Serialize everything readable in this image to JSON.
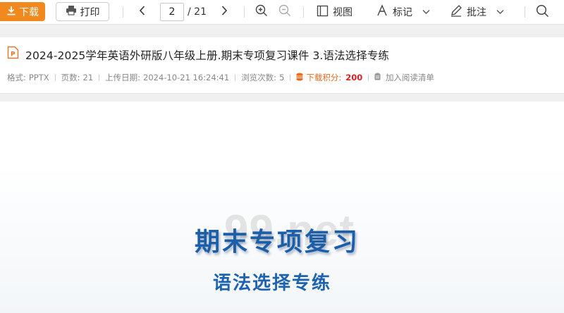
{
  "toolbar": {
    "download_label": "下载",
    "print_label": "打印",
    "current_page": "2",
    "total_pages": "/ 21",
    "view_label": "视图",
    "mark_label": "标记",
    "annotate_label": "批注"
  },
  "document": {
    "title": "2024-2025学年英语外研版八年级上册.期末专项复习课件 3.语法选择专练",
    "meta": {
      "format_label": "格式:",
      "format_value": "PPTX",
      "pages_label": "页数:",
      "pages_value": "21",
      "upload_label": "上传日期:",
      "upload_value": "2024-10-21 16:24:41",
      "views_label": "浏览次数:",
      "views_value": "5",
      "points_label": "下载积分:",
      "points_value": "200",
      "add_reading_list": "加入阅读清单"
    }
  },
  "slide": {
    "title": "期末专项复习",
    "subtitle": "语法选择专练",
    "watermark": "99.net"
  },
  "colors": {
    "accent_orange": "#f08a1e",
    "slide_blue": "#1c5fa8",
    "points_red": "#e02020"
  },
  "icons": [
    "download-icon",
    "printer-icon",
    "chevron-left-icon",
    "chevron-right-icon",
    "zoom-in-icon",
    "zoom-out-icon",
    "view-icon",
    "highlighter-icon",
    "pen-icon",
    "search-icon",
    "pptx-file-icon",
    "coin-stack-icon",
    "clipboard-icon"
  ]
}
